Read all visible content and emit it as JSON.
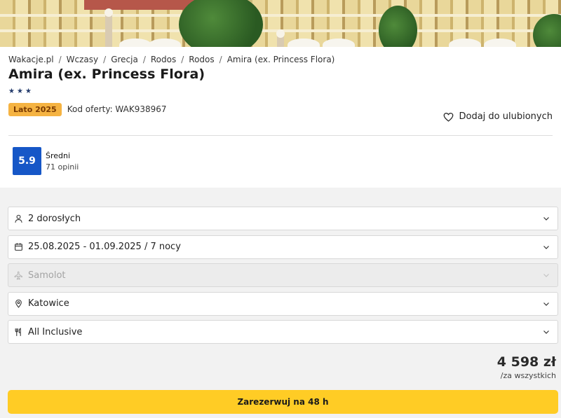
{
  "breadcrumbs": [
    "Wakacje.pl",
    "Wczasy",
    "Grecja",
    "Rodos",
    "Rodos",
    "Amira (ex. Princess Flora)"
  ],
  "breadcrumb_separator": "/",
  "hotel": {
    "name": "Amira (ex. Princess Flora)",
    "stars": 3,
    "season_badge": "Lato 2025",
    "offer_code": "Kod oferty: WAK938967",
    "favorite_label": "Dodaj do ulubionych"
  },
  "rating": {
    "score": "5.9",
    "label": "Średni",
    "count": "71 opinii",
    "color": "#1657c7"
  },
  "form": {
    "travelers": {
      "value": "2 dorosłych",
      "icon": "person-icon"
    },
    "dates": {
      "value": "25.08.2025 - 01.09.2025 / 7 nocy",
      "icon": "calendar-icon"
    },
    "transport": {
      "value": "Samolot",
      "icon": "plane-icon",
      "disabled": true
    },
    "departure": {
      "value": "Katowice",
      "icon": "location-pin-icon"
    },
    "board": {
      "value": "All Inclusive",
      "icon": "cutlery-icon"
    }
  },
  "price": {
    "amount": "4 598 zł",
    "per": "/za wszystkich"
  },
  "book_button": {
    "label": "Zarezerwuj na 48 h",
    "color": "#ffcc25"
  },
  "colors": {
    "badge": "#f5b342",
    "stars": "#233a6b"
  }
}
